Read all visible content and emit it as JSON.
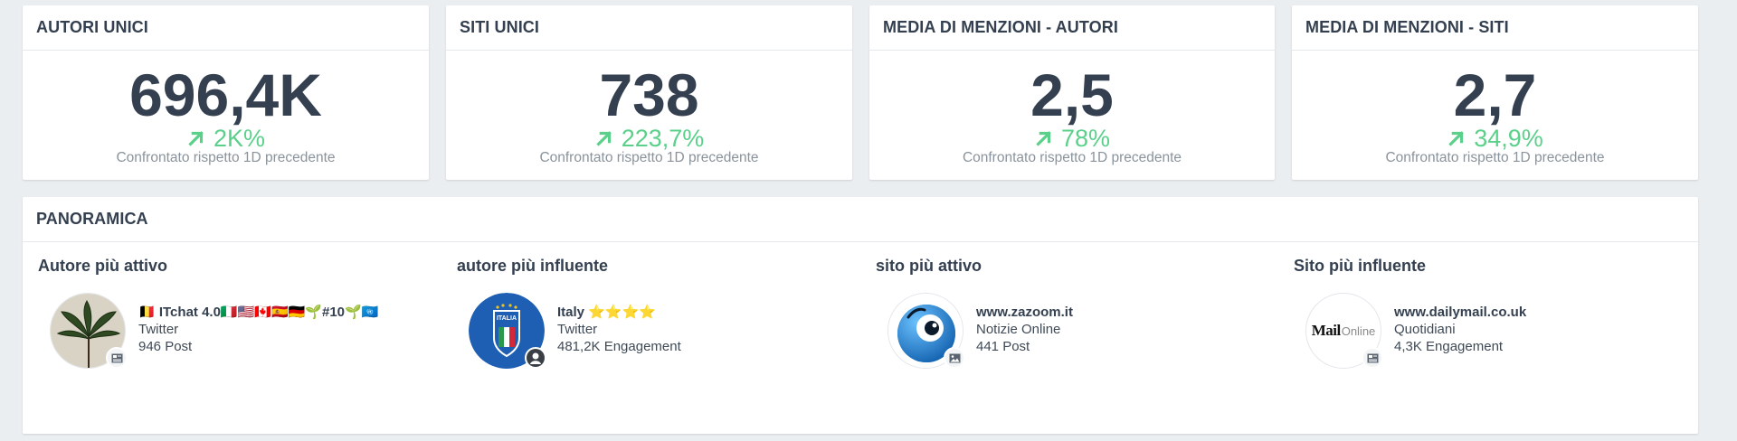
{
  "kpis": [
    {
      "title": "AUTORI UNICI",
      "value": "696,4K",
      "change": "2K%",
      "compare": "Confrontato rispetto 1D precedente"
    },
    {
      "title": "SITI UNICI",
      "value": "738",
      "change": "223,7%",
      "compare": "Confrontato rispetto 1D precedente"
    },
    {
      "title": "MEDIA DI MENZIONI - AUTORI",
      "value": "2,5",
      "change": "78%",
      "compare": "Confrontato rispetto 1D precedente"
    },
    {
      "title": "MEDIA DI MENZIONI - SITI",
      "value": "2,7",
      "change": "34,9%",
      "compare": "Confrontato rispetto 1D precedente"
    }
  ],
  "overview": {
    "title": "PANORAMICA",
    "sections": [
      {
        "title": "Autore più attivo",
        "name": "🇧🇪 ITchat 4.0🇮🇹🇺🇸🇨🇦🇪🇸🇩🇪🌱#10🌱🇺🇳",
        "source": "Twitter",
        "metric": "946 Post",
        "avatar": "cannabis-leaf-avatar",
        "badge": "news-icon"
      },
      {
        "title": "autore più influente",
        "name": "Italy ⭐⭐⭐⭐",
        "source": "Twitter",
        "metric": "481,2K Engagement",
        "avatar": "italia-crest-avatar",
        "badge": "user-icon"
      },
      {
        "title": "sito più attivo",
        "name": "www.zazoom.it",
        "source": "Notizie Online",
        "metric": "441 Post",
        "avatar": "zazoom-logo-avatar",
        "badge": "image-icon"
      },
      {
        "title": "Sito più influente",
        "name": "www.dailymail.co.uk",
        "source": "Quotidiani",
        "metric": "4,3K Engagement",
        "avatar": "mailonline-logo-avatar",
        "badge": "news-icon"
      }
    ]
  },
  "colors": {
    "accent_green": "#5bd08b",
    "text_dark": "#344050",
    "text_muted": "#8a939c",
    "background": "#ebeef1"
  },
  "logo_text": {
    "mail": "Mail",
    "online": "Online",
    "italia": "ITALIA"
  }
}
